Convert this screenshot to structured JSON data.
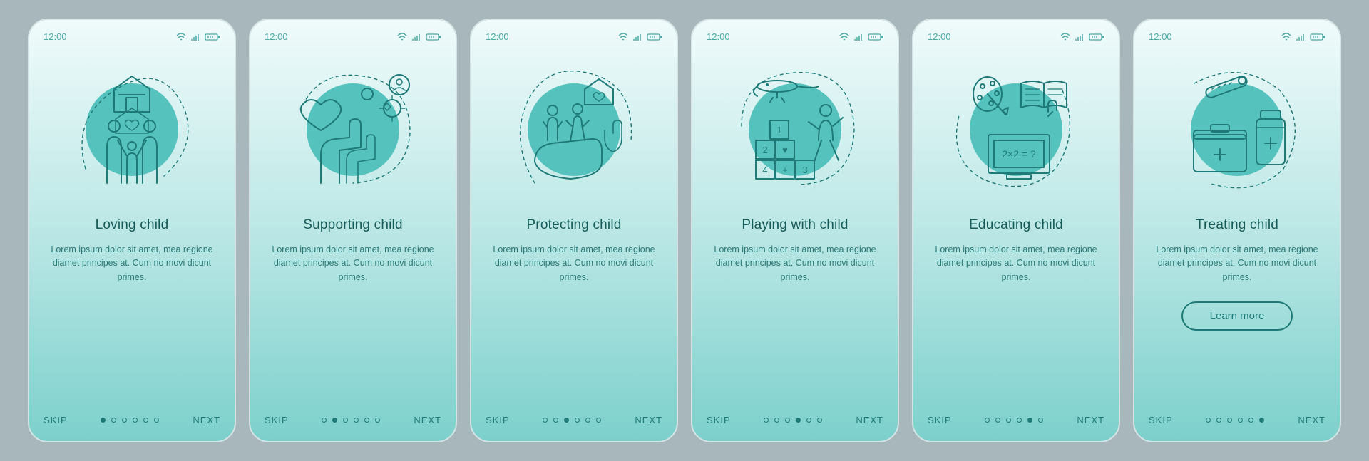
{
  "status": {
    "time": "12:00"
  },
  "slides": [
    {
      "title": "Loving child",
      "desc": "Lorem ipsum dolor sit amet, mea regione diamet principes at. Cum no movi dicunt primes.",
      "icon": "family-home"
    },
    {
      "title": "Supporting child",
      "desc": "Lorem ipsum dolor sit amet, mea regione diamet principes at. Cum no movi dicunt primes.",
      "icon": "hands-heart"
    },
    {
      "title": "Protecting child",
      "desc": "Lorem ipsum dolor sit amet, mea regione diamet principes at. Cum no movi dicunt primes.",
      "icon": "shield-kids"
    },
    {
      "title": "Playing with child",
      "desc": "Lorem ipsum dolor sit amet, mea regione diamet principes at. Cum no movi dicunt primes.",
      "icon": "play-blocks"
    },
    {
      "title": "Educating child",
      "desc": "Lorem ipsum dolor sit amet, mea regione diamet principes at. Cum no movi dicunt primes.",
      "icon": "education"
    },
    {
      "title": "Treating child",
      "desc": "Lorem ipsum dolor sit amet, mea regione diamet principes at. Cum no movi dicunt primes.",
      "icon": "medical",
      "cta": "Learn more"
    }
  ],
  "nav": {
    "skip": "SKIP",
    "next": "NEXT"
  },
  "dot_count": 6
}
